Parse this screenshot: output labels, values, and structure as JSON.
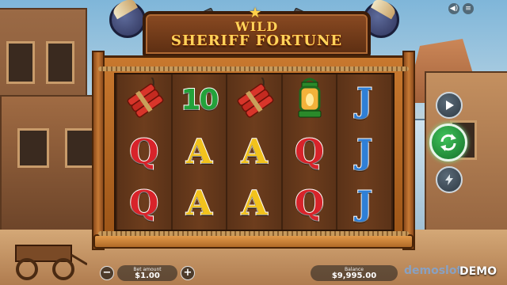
{
  "game": {
    "title_line1": "WILD",
    "title_line2": "SHERIFF FORTUNE"
  },
  "reels": [
    [
      {
        "kind": "dynamite",
        "icon": "dynamite-icon"
      },
      {
        "kind": "letter",
        "text": "Q",
        "color": "#d8232a"
      },
      {
        "kind": "letter",
        "text": "Q",
        "color": "#d8232a"
      }
    ],
    [
      {
        "kind": "ten",
        "text": "10",
        "color": "#23a23a"
      },
      {
        "kind": "letter",
        "text": "A",
        "color": "#f2c21d"
      },
      {
        "kind": "letter",
        "text": "A",
        "color": "#f2c21d"
      }
    ],
    [
      {
        "kind": "dynamite",
        "icon": "dynamite-icon"
      },
      {
        "kind": "letter",
        "text": "A",
        "color": "#f2c21d"
      },
      {
        "kind": "letter",
        "text": "A",
        "color": "#f2c21d"
      }
    ],
    [
      {
        "kind": "lantern",
        "icon": "lantern-icon"
      },
      {
        "kind": "letter",
        "text": "Q",
        "color": "#d8232a"
      },
      {
        "kind": "letter",
        "text": "Q",
        "color": "#d8232a"
      }
    ],
    [
      {
        "kind": "letter",
        "text": "J",
        "color": "#2f7fd6"
      },
      {
        "kind": "letter",
        "text": "J",
        "color": "#2f7fd6"
      },
      {
        "kind": "letter",
        "text": "J",
        "color": "#2f7fd6"
      }
    ]
  ],
  "controls": {
    "play_icon": "play-icon",
    "spin_icon": "spin-arrows-icon",
    "turbo_icon": "lightning-icon",
    "sound_icon": "speaker-icon",
    "menu_icon": "menu-icon"
  },
  "bottom_bar": {
    "bet_label": "Bet amount",
    "bet_value": "$1.00",
    "minus_label": "−",
    "plus_label": "+",
    "balance_label": "Balance",
    "balance_value": "$9,995.00",
    "watermark": "demoslot",
    "demo_label": "DEMO"
  },
  "colors": {
    "spin_button": "#23a23a",
    "frame_wood": "#c8782e",
    "title_gold": "#ffd45a"
  }
}
